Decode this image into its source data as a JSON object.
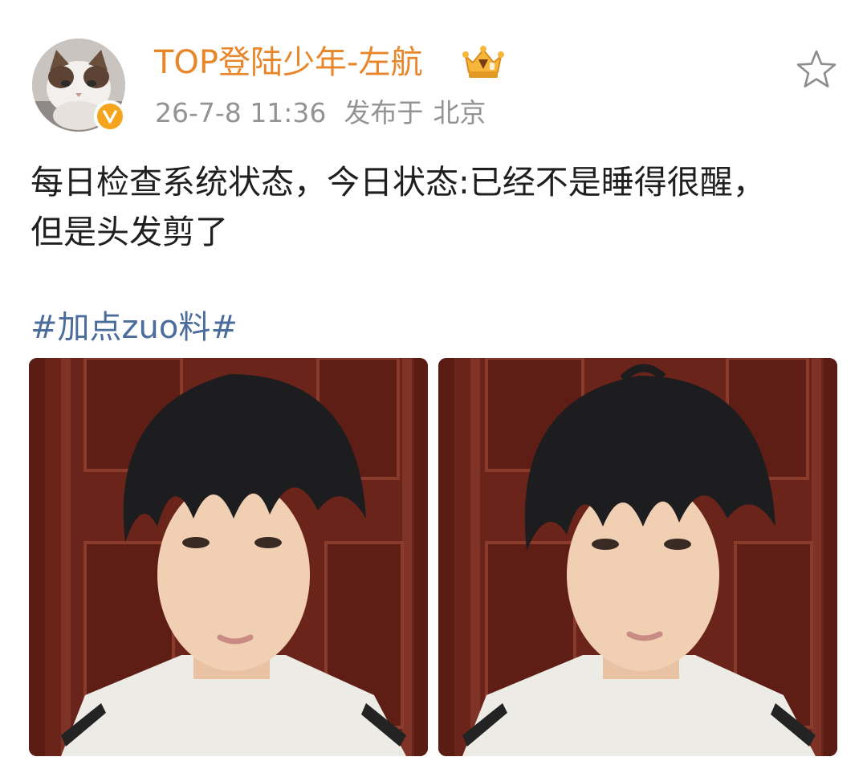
{
  "post": {
    "author": {
      "name": "TOP登陆少年-左航",
      "avatar_icon": "cat-avatar",
      "verified_icon": "verified-v-icon",
      "member_icon": "crown-member-icon"
    },
    "meta": {
      "date": "26-7-8",
      "time": "11:36",
      "publish_label": "发布于",
      "location": "北京"
    },
    "favorite_icon": "star-outline-icon",
    "text_lines": [
      "每日检查系统状态，今日状态:已经不是睡得很醒，",
      "但是头发剪了"
    ],
    "hashtag": "#加点zuo料#",
    "photos": [
      {
        "name": "photo-1"
      },
      {
        "name": "photo-2"
      }
    ]
  },
  "colors": {
    "username": "#e8862a",
    "meta": "#939393",
    "text": "#1f1f1f",
    "hashtag": "#4b6d9c",
    "badge": "#f4a51d"
  }
}
